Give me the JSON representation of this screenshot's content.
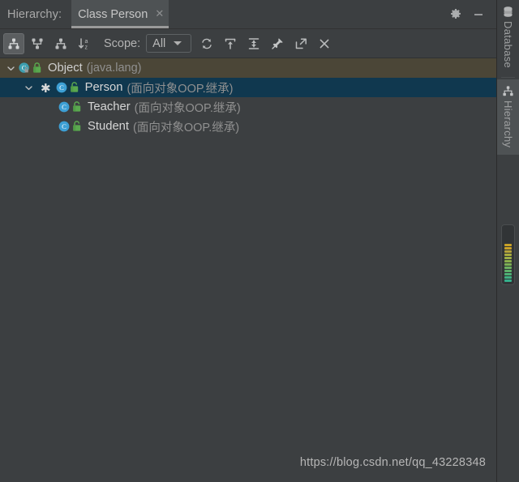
{
  "header": {
    "hierarchy_label": "Hierarchy:",
    "tab": {
      "title": "Class Person",
      "close_glyph": "✕"
    },
    "settings_icon": "gear-icon",
    "minimize_icon": "minimize-icon"
  },
  "toolbar": {
    "buttons": [
      {
        "name": "type-hierarchy-button",
        "icon": "type-hierarchy-icon",
        "selected": true,
        "title": "Class Hierarchy"
      },
      {
        "name": "supertypes-hierarchy-button",
        "icon": "supertypes-icon",
        "selected": false,
        "title": "Supertypes Hierarchy"
      },
      {
        "name": "subtypes-hierarchy-button",
        "icon": "subtypes-icon",
        "selected": false,
        "title": "Subtypes Hierarchy"
      },
      {
        "name": "sort-alphabetically-button",
        "icon": "sort-alphabetically-icon",
        "selected": false,
        "title": "Sort Alphabetically"
      }
    ],
    "scope_label": "Scope:",
    "scope_value": "All",
    "scope_options": [
      "All"
    ],
    "right_buttons": [
      {
        "name": "refresh-button",
        "icon": "refresh-icon",
        "title": "Refresh"
      },
      {
        "name": "expand-all-button",
        "icon": "expand-all-icon",
        "title": "Expand All"
      },
      {
        "name": "collapse-all-button",
        "icon": "collapse-all-icon",
        "title": "Collapse All"
      },
      {
        "name": "pin-tab-button",
        "icon": "pin-icon",
        "title": "Pin Tab"
      },
      {
        "name": "open-in-new-window-button",
        "icon": "export-icon",
        "title": "Open in New Window"
      },
      {
        "name": "close-button",
        "icon": "close-icon",
        "title": "Close"
      }
    ]
  },
  "tree": {
    "nodes": [
      {
        "name": "Object",
        "package": "(java.lang)",
        "depth": 0,
        "expanded": true,
        "has_twisty": true,
        "marked": false,
        "locked": true,
        "state": "root",
        "icon": "class-icon"
      },
      {
        "name": "Person",
        "package": "(面向对象OOP.继承)",
        "depth": 1,
        "expanded": true,
        "has_twisty": true,
        "marked": true,
        "locked": false,
        "state": "selected",
        "icon": "class-icon"
      },
      {
        "name": "Teacher",
        "package": "(面向对象OOP.继承)",
        "depth": 2,
        "expanded": false,
        "has_twisty": false,
        "marked": false,
        "locked": false,
        "state": "normal",
        "icon": "class-icon"
      },
      {
        "name": "Student",
        "package": "(面向对象OOP.继承)",
        "depth": 2,
        "expanded": false,
        "has_twisty": false,
        "marked": false,
        "locked": false,
        "state": "normal",
        "icon": "class-icon"
      }
    ],
    "marked_glyph": "✱"
  },
  "watermark": {
    "text": "https://blog.csdn.net/qq_43228348"
  },
  "right_toolwindows": [
    {
      "name": "database-tool-window",
      "label": "Database",
      "icon": "database-icon",
      "active": false
    },
    {
      "name": "hierarchy-tool-window",
      "label": "Hierarchy",
      "icon": "hierarchy-icon",
      "active": true
    }
  ],
  "colors": {
    "background": "#3c3f41",
    "tab_active": "#4e5254",
    "row_root": "#4b4637",
    "row_selected": "#10384f",
    "class_badge": "#3d9fd4",
    "class_badge_root": "#3d9fb0",
    "lock_green": "#5aa84f",
    "text": "#d6d6d6",
    "text_muted": "#909090"
  },
  "stripe_marks": [
    "#c9a227",
    "#c9a227",
    "#b5a43a",
    "#a8ab3e",
    "#9aad45",
    "#8bae4b",
    "#7caf55",
    "#6cb05f",
    "#5cb06a",
    "#4db075",
    "#3fb081",
    "#35b08c"
  ]
}
